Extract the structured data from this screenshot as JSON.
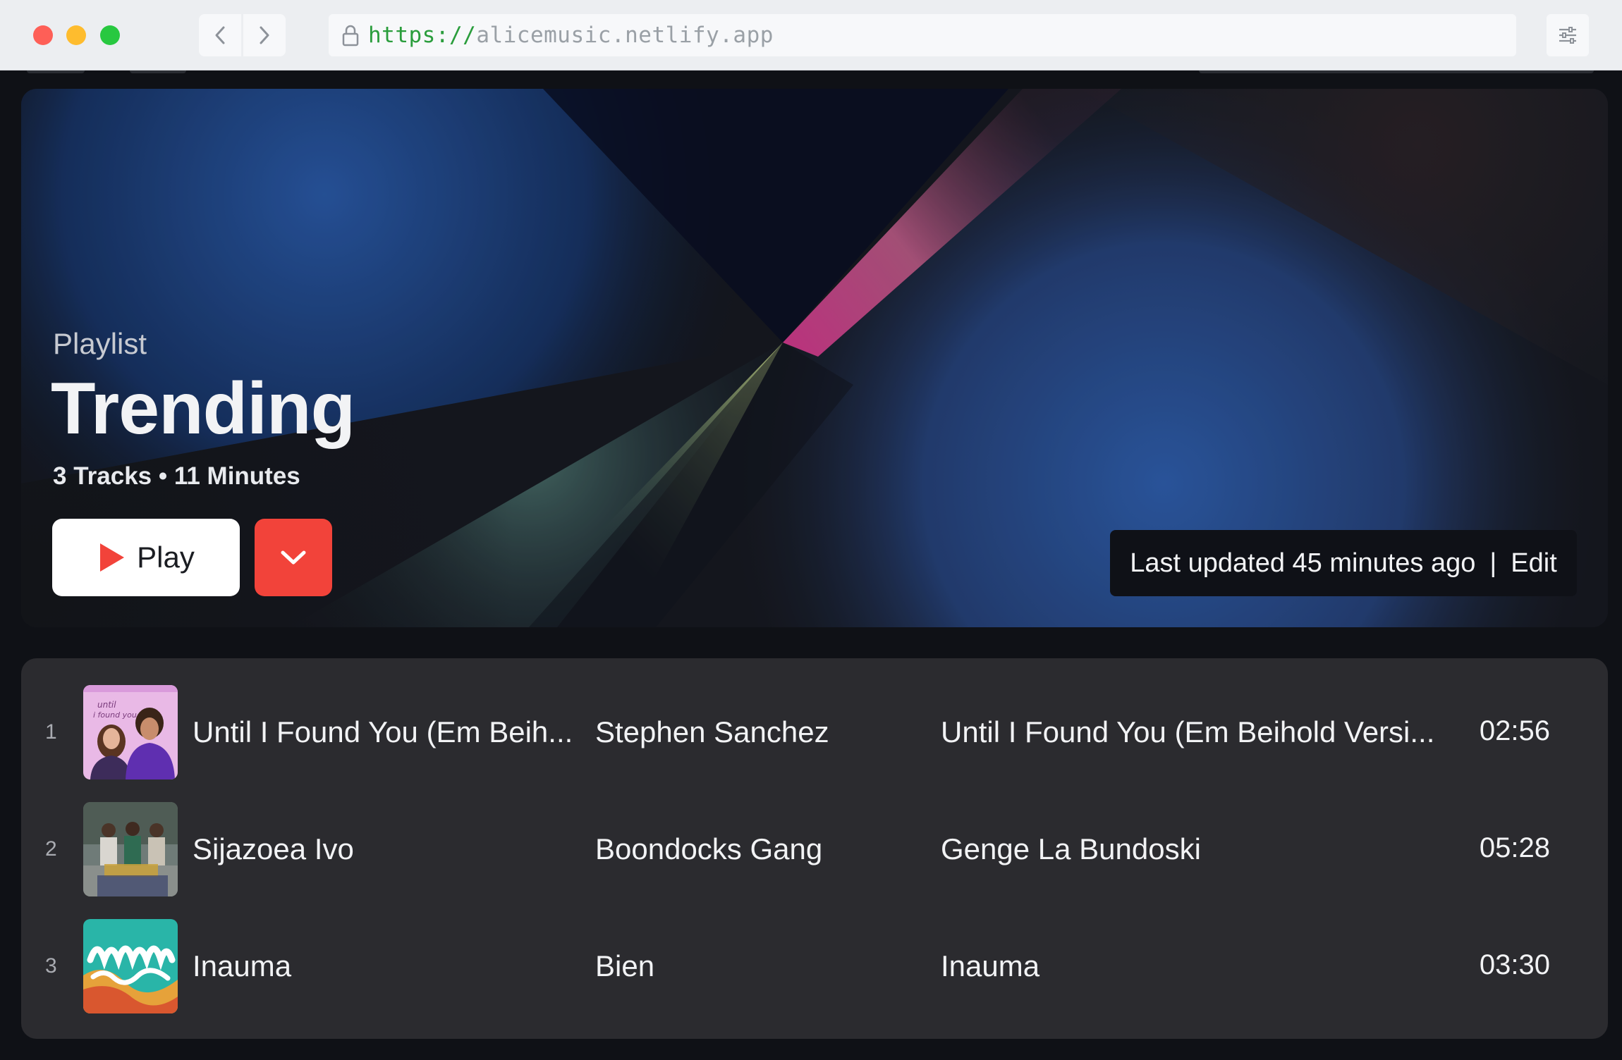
{
  "browser": {
    "url_scheme": "https://",
    "url_host": "alicemusic.netlify.app"
  },
  "hero": {
    "label": "Playlist",
    "title": "Trending",
    "meta": "3 Tracks • 11 Minutes",
    "play_label": "Play",
    "updated_text": "Last updated 45 minutes ago",
    "separator": "|",
    "edit_label": "Edit"
  },
  "tracks": [
    {
      "number": "1",
      "title": "Until I Found You (Em Beih...",
      "artist": "Stephen Sanchez",
      "album": "Until I Found You (Em Beihold Versi...",
      "duration": "02:56"
    },
    {
      "number": "2",
      "title": "Sijazoea Ivo",
      "artist": "Boondocks Gang",
      "album": "Genge La Bundoski",
      "duration": "05:28"
    },
    {
      "number": "3",
      "title": "Inauma",
      "artist": "Bien",
      "album": "Inauma",
      "duration": "03:30"
    }
  ],
  "colors": {
    "accent": "#f2433a",
    "page_background": "#0f1116",
    "list_background": "#2b2b2f"
  }
}
